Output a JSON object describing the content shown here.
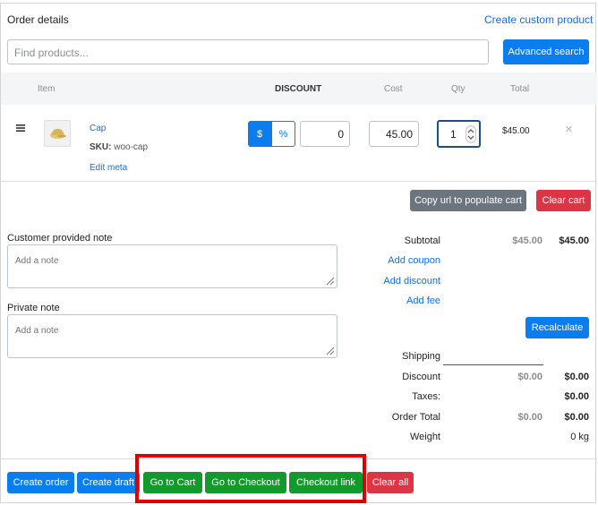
{
  "header": {
    "title": "Order details",
    "create_custom_product": "Create custom product"
  },
  "search": {
    "placeholder": "Find products...",
    "advanced_search": "Advanced search"
  },
  "table": {
    "columns": {
      "item": "Item",
      "discount": "DISCOUNT",
      "cost": "Cost",
      "qty": "Qty",
      "total": "Total"
    }
  },
  "line_item": {
    "name": "Cap",
    "sku_label": "SKU:",
    "sku_value": "woo-cap",
    "edit_meta": "Edit meta",
    "discount_currency": "$",
    "discount_percent": "%",
    "discount_value": "0",
    "cost": "45.00",
    "qty": "1",
    "total": "$45.00",
    "remove": "×"
  },
  "cart_actions": {
    "copy_url": "Copy url to populate cart",
    "clear_cart": "Clear cart"
  },
  "notes": {
    "customer_label": "Customer provided note",
    "customer_placeholder": "Add a note",
    "private_label": "Private note",
    "private_placeholder": "Add a note"
  },
  "totals": {
    "subtotal_label": "Subtotal",
    "subtotal_old": "$45.00",
    "subtotal_value": "$45.00",
    "add_coupon": "Add coupon",
    "add_discount": "Add discount",
    "add_fee": "Add fee",
    "recalculate": "Recalculate",
    "shipping_label": "Shipping",
    "discount_label": "Discount",
    "discount_old": "$0.00",
    "discount_value": "$0.00",
    "taxes_label": "Taxes:",
    "taxes_value": "$0.00",
    "order_total_label": "Order Total",
    "order_total_old": "$0.00",
    "order_total_value": "$0.00",
    "weight_label": "Weight",
    "weight_value": "0 kg"
  },
  "footer": {
    "create_order": "Create order",
    "create_draft": "Create draft",
    "go_to_cart": "Go to Cart",
    "go_to_checkout": "Go to Checkout",
    "checkout_link": "Checkout link",
    "clear_all": "Clear all"
  },
  "colors": {
    "primary": "#0b7dee",
    "danger": "#dc3545",
    "success": "#139a2d",
    "secondary": "#6c757d",
    "highlight": "#e00000"
  }
}
